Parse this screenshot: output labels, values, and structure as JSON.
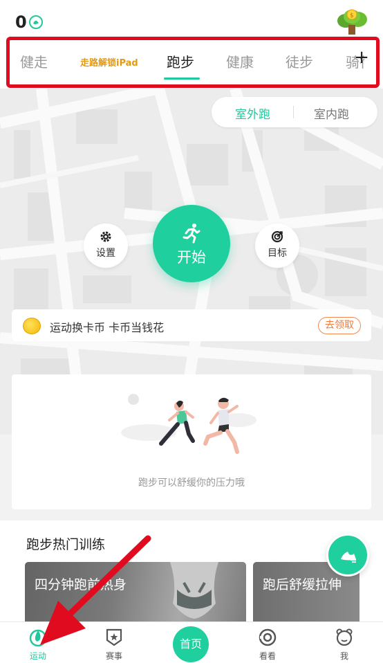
{
  "header": {
    "coin_count": "0"
  },
  "tabs": [
    {
      "label": "健走"
    },
    {
      "label": "走路解锁iPad"
    },
    {
      "label": "跑步"
    },
    {
      "label": "健康"
    },
    {
      "label": "徒步"
    },
    {
      "label": "骑行"
    }
  ],
  "tabs_add": "+",
  "mode": {
    "outdoor": "室外跑",
    "indoor": "室内跑"
  },
  "controls": {
    "settings": "设置",
    "start": "开始",
    "goal": "目标"
  },
  "coin_banner": {
    "text": "运动换卡币 卡币当钱花",
    "claim": "去领取"
  },
  "illustration": {
    "caption": "跑步可以舒缓你的压力哦"
  },
  "training": {
    "title": "跑步热门训练",
    "cards": [
      {
        "title": "四分钟跑前热身"
      },
      {
        "title": "跑后舒缓拉伸"
      }
    ]
  },
  "bottom_nav": [
    {
      "label": "运动",
      "icon": "sport-icon"
    },
    {
      "label": "赛事",
      "icon": "event-icon"
    },
    {
      "label": "首页",
      "icon": "home"
    },
    {
      "label": "看看",
      "icon": "watch-icon"
    },
    {
      "label": "我",
      "icon": "profile-icon"
    }
  ],
  "colors": {
    "accent": "#1fcf9e",
    "annotation_red": "#e00b1e",
    "claim_orange": "#f07a38"
  }
}
